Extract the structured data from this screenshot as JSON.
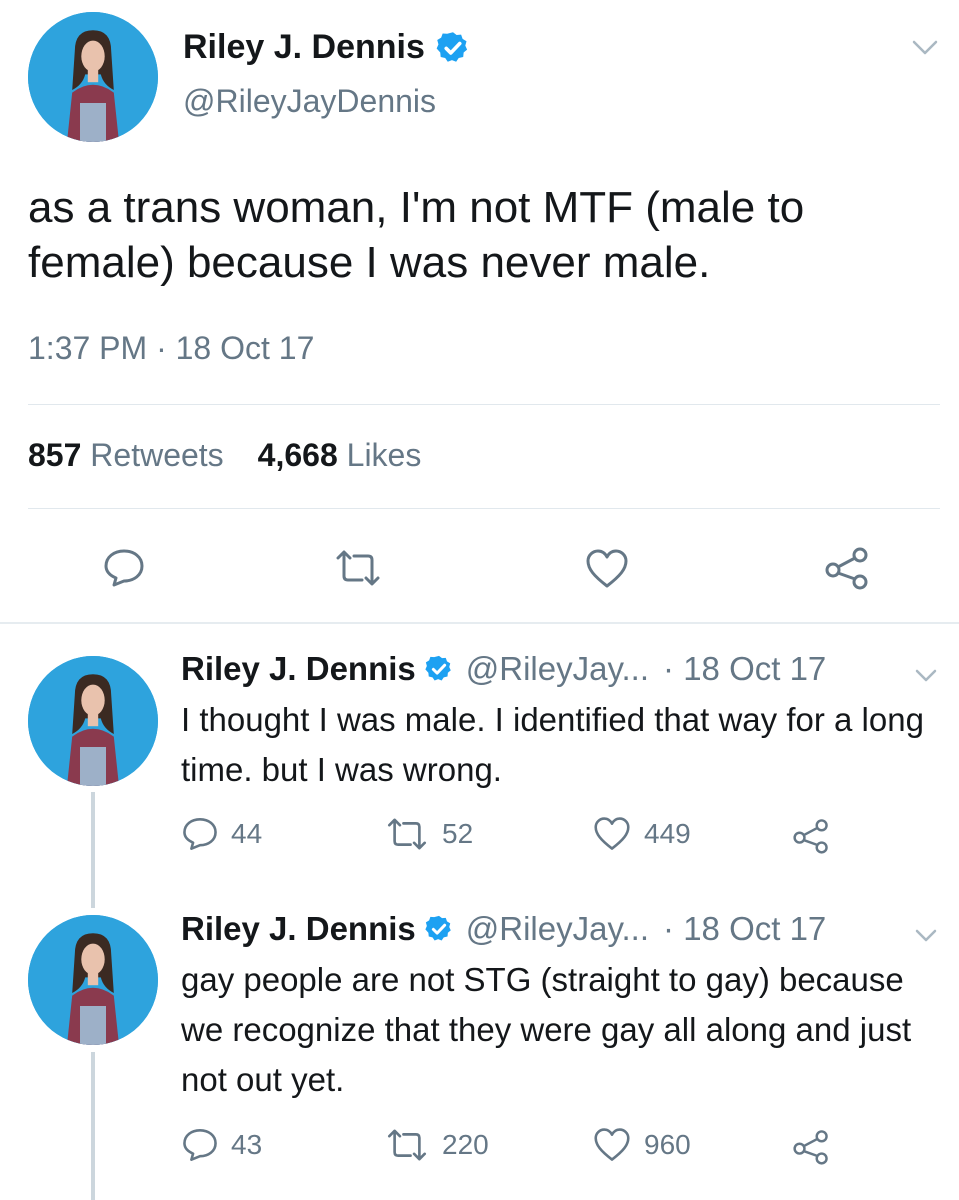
{
  "main_tweet": {
    "author_name": "Riley J. Dennis",
    "author_handle": "@RileyJayDennis",
    "text": "as a trans woman, I'm not MTF (male to female) because I was never male.",
    "timestamp": "1:37 PM · 18 Oct 17",
    "retweets_count": "857",
    "retweets_label": "Retweets",
    "likes_count": "4,668",
    "likes_label": "Likes"
  },
  "replies": [
    {
      "author_name": "Riley J. Dennis",
      "author_handle": "@RileyJay...",
      "date": "· 18 Oct 17",
      "text": "I thought I was male. I identified that way for a long time. but I was wrong.",
      "reply_count": "44",
      "retweet_count": "52",
      "like_count": "449"
    },
    {
      "author_name": "Riley J. Dennis",
      "author_handle": "@RileyJay...",
      "date": "· 18 Oct 17",
      "text": "gay people are not STG (straight to gay) because we recognize that they were gay all along and just not out yet.",
      "reply_count": "43",
      "retweet_count": "220",
      "like_count": "960"
    }
  ],
  "icons": {
    "verified": "verified-badge-icon",
    "menu": "chevron-down-icon",
    "reply": "speech-bubble-icon",
    "retweet": "retweet-arrows-icon",
    "like": "heart-outline-icon",
    "share": "share-nodes-icon"
  },
  "colors": {
    "verified_blue": "#1da1f2",
    "secondary_text": "#657786",
    "primary_text": "#14171a",
    "divider": "#e1e8ed",
    "thread_line": "#ccd6dd",
    "avatar_background": "#2ea3dd"
  }
}
